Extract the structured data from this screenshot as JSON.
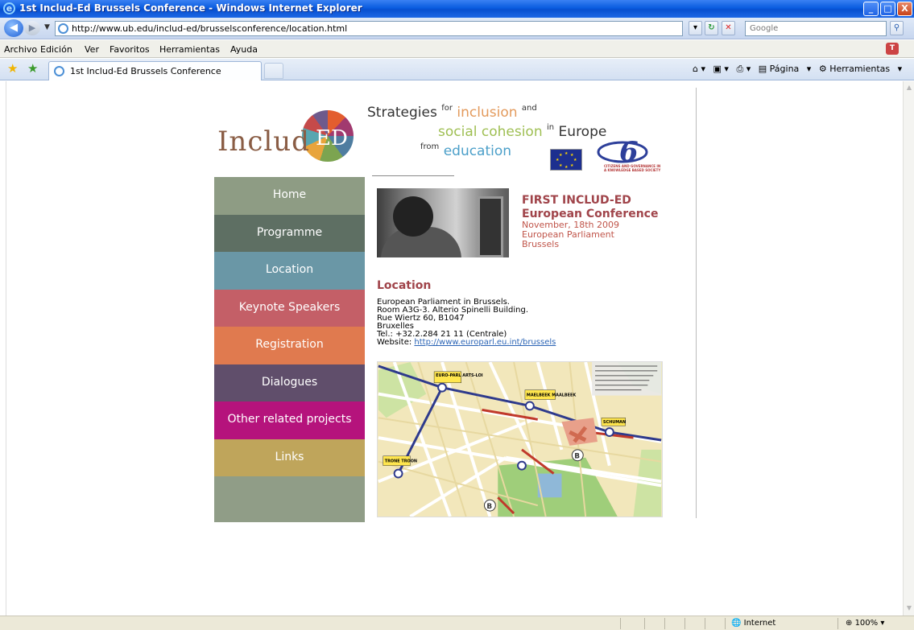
{
  "window": {
    "title": "1st Includ-Ed Brussels Conference - Windows Internet Explorer",
    "controls": {
      "minimize": "_",
      "maximize": "□",
      "close": "X"
    }
  },
  "navbar": {
    "url": "http://www.ub.edu/includ-ed/brusselsconference/location.html",
    "search_placeholder": "Google"
  },
  "menubar": {
    "items": [
      "Archivo",
      "Edición",
      "Ver",
      "Favoritos",
      "Herramientas",
      "Ayuda"
    ]
  },
  "tabs": {
    "active_tab": "1st Includ-Ed Brussels Conference",
    "commands": {
      "page": "Página",
      "tools": "Herramientas"
    }
  },
  "site": {
    "logo": {
      "prefix": "Includ",
      "suffix": "ED"
    },
    "tagline": {
      "strategies": "Strategies",
      "for": "for",
      "inclusion": "inclusion",
      "and": "and",
      "social_cohesion": "social cohesion",
      "in": "in",
      "europe": "Europe",
      "from": "from",
      "education": "education"
    },
    "fp6_caption": [
      "CITIZENS AND GOVERNANCE IN",
      "A KNOWLEDGE BASED SOCIETY"
    ]
  },
  "nav": {
    "items": [
      {
        "label": "Home",
        "color": "#8e9c84"
      },
      {
        "label": "Programme",
        "color": "#5e6f63"
      },
      {
        "label": "Location",
        "color": "#6a97a6"
      },
      {
        "label": "Keynote Speakers",
        "color": "#c45f67"
      },
      {
        "label": "Registration",
        "color": "#e07a4f"
      },
      {
        "label": "Dialogues",
        "color": "#604e6b"
      },
      {
        "label": "Other related projects",
        "color": "#b5137c"
      },
      {
        "label": "Links",
        "color": "#bfa55b"
      }
    ]
  },
  "conference": {
    "title_line1": "FIRST INCLUD-ED",
    "title_line2": "European Conference",
    "date": "November, 18th 2009",
    "venue": "European Parliament",
    "city": "Brussels"
  },
  "location": {
    "heading": "Location",
    "lines": [
      "European Parliament in Brussels.",
      "Room A3G-3. Alterio Spinelli Building.",
      "Rue Wiertz 60, B1047",
      "Bruxelles",
      "Tel.: +32.2.284 21 11 (Centrale)"
    ],
    "website_label": "Website: ",
    "website_url": "http://www.europarl.eu.int/brussels"
  },
  "map": {
    "labels": [
      "EURO-PARL ARTS-LOI",
      "MAELBEEK MAALBEEK",
      "SCHUMAN",
      "TRONE TROON"
    ]
  },
  "statusbar": {
    "zone": "Internet",
    "zoom": "100%"
  }
}
